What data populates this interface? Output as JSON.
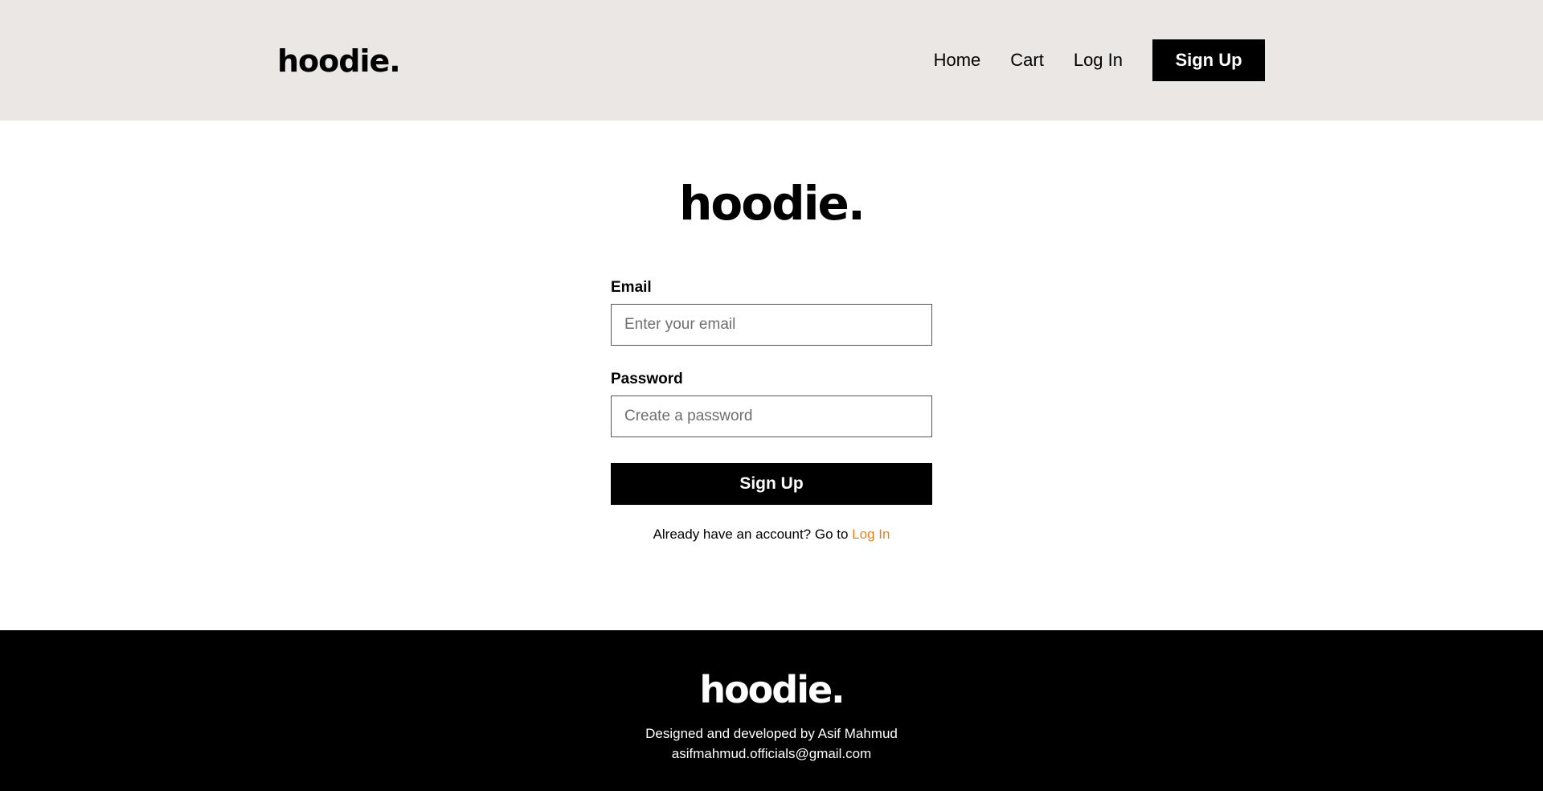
{
  "header": {
    "brand": "hoodie.",
    "nav": {
      "home": "Home",
      "cart": "Cart",
      "login": "Log In",
      "signup": "Sign Up"
    }
  },
  "form": {
    "brand": "hoodie.",
    "email_label": "Email",
    "email_placeholder": "Enter your email",
    "email_value": "",
    "password_label": "Password",
    "password_placeholder": "Create a password",
    "password_value": "",
    "submit_label": "Sign Up",
    "hint_text": "Already have an account? Go to ",
    "hint_link": "Log In"
  },
  "footer": {
    "brand": "hoodie.",
    "credit": "Designed and developed by Asif Mahmud",
    "email": "asifmahmud.officials@gmail.com"
  },
  "colors": {
    "header_bg": "#eae7e5",
    "accent_link": "#f07f0f",
    "primary_button": "#000000",
    "footer_bg": "#000000"
  }
}
